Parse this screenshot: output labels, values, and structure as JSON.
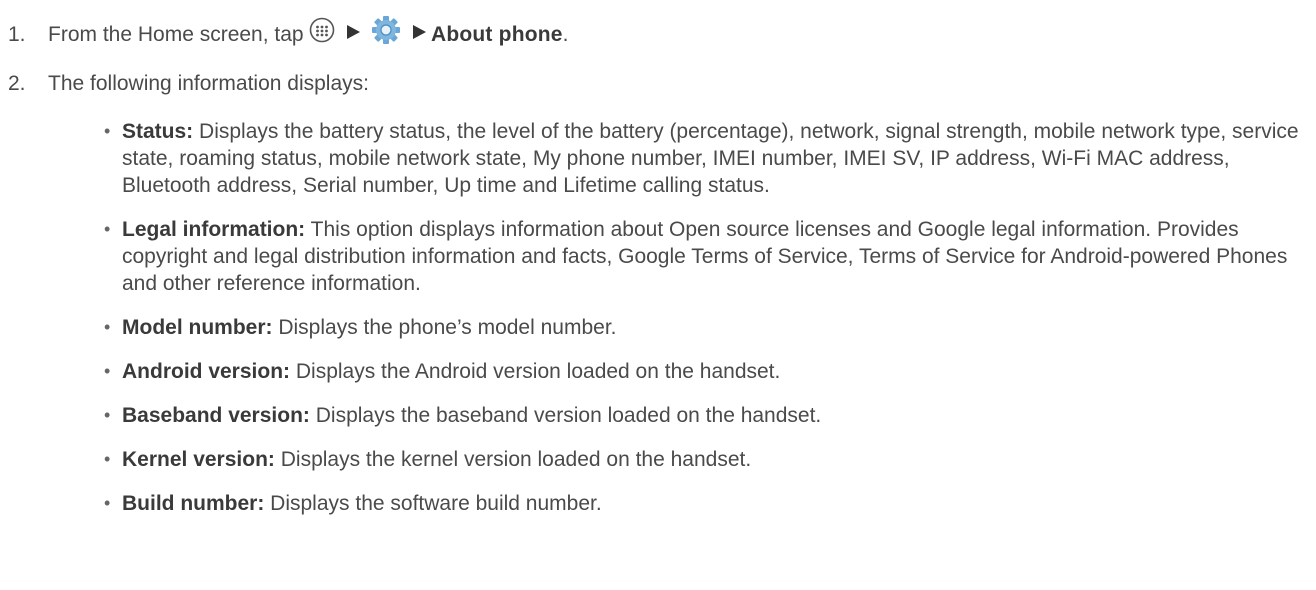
{
  "steps": [
    {
      "number": "1.",
      "prefix": "From the Home screen, tap",
      "apps_icon": "apps-grid-icon",
      "settings_icon": "settings-gear-icon",
      "arrow_icon": "play-arrow-icon",
      "target": "About phone",
      "suffix": "."
    },
    {
      "number": "2.",
      "text": "The following information displays:"
    }
  ],
  "items": [
    {
      "term": "Status:",
      "desc": "Displays the battery status, the level of the battery (percentage), network, signal strength, mobile network type, service state, roaming status, mobile network state, My phone number, IMEI number, IMEI SV, IP address, Wi-Fi MAC address, Bluetooth address, Serial number, Up time and Lifetime calling status."
    },
    {
      "term": "Legal information:",
      "desc": "This option displays information about Open source licenses and Google legal information. Provides copyright and legal distribution information and facts, Google Terms of Service, Terms of Service for Android-powered Phones and other reference information."
    },
    {
      "term": "Model number:",
      "desc": "Displays the phone’s model number."
    },
    {
      "term": "Android version:",
      "desc": "Displays the Android version loaded on the handset."
    },
    {
      "term": "Baseband version:",
      "desc": "Displays the baseband version loaded on the handset."
    },
    {
      "term": "Kernel version:",
      "desc": "Displays the kernel version loaded on the handset."
    },
    {
      "term": "Build number:",
      "desc": "Displays the software build number."
    }
  ],
  "colors": {
    "text": "#4a4a4a",
    "bold_text": "#3a3a3a",
    "gear_blue": "#6aa7d6"
  }
}
